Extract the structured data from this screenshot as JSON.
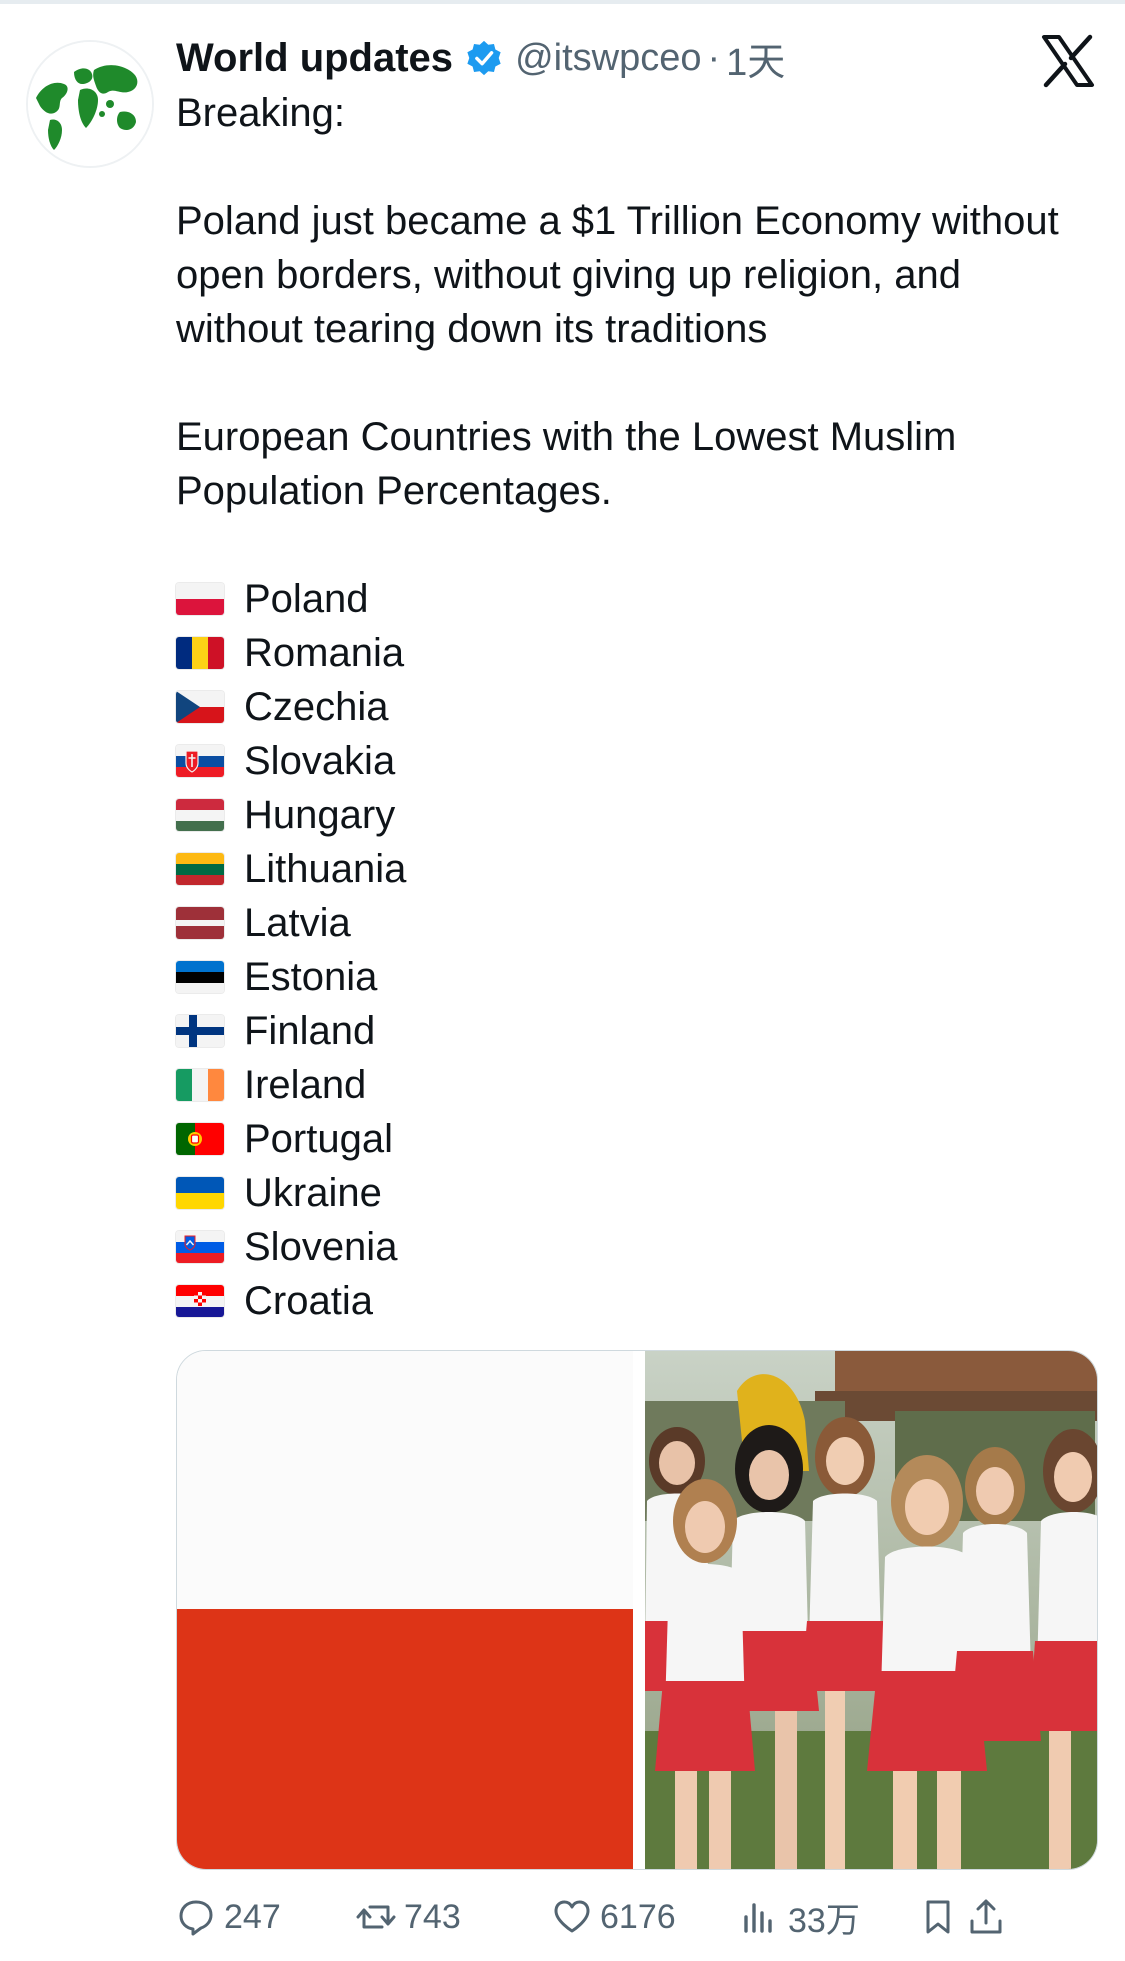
{
  "accent_color": "#1d9bf0",
  "post": {
    "author": {
      "display_name": "World updates",
      "handle": "@itswpceo",
      "separator": "·",
      "time": "1天",
      "verified": true,
      "avatar_icon": "globe-avatar-icon"
    },
    "platform_icon": "x-logo-icon",
    "text": {
      "line1": "Breaking:",
      "paragraph2": "Poland just became a $1 Trillion Economy without open borders, without giving up religion, and without tearing down its traditions",
      "paragraph3": "European Countries with the Lowest Muslim Population Percentages."
    },
    "countries": [
      {
        "name": "Poland",
        "flag": "flag-poland-icon"
      },
      {
        "name": "Romania",
        "flag": "flag-romania-icon"
      },
      {
        "name": "Czechia",
        "flag": "flag-czechia-icon"
      },
      {
        "name": "Slovakia",
        "flag": "flag-slovakia-icon"
      },
      {
        "name": "Hungary",
        "flag": "flag-hungary-icon"
      },
      {
        "name": "Lithuania",
        "flag": "flag-lithuania-icon"
      },
      {
        "name": "Latvia",
        "flag": "flag-latvia-icon"
      },
      {
        "name": "Estonia",
        "flag": "flag-estonia-icon"
      },
      {
        "name": "Finland",
        "flag": "flag-finland-icon"
      },
      {
        "name": "Ireland",
        "flag": "flag-ireland-icon"
      },
      {
        "name": "Portugal",
        "flag": "flag-portugal-icon"
      },
      {
        "name": "Ukraine",
        "flag": "flag-ukraine-icon"
      },
      {
        "name": "Slovenia",
        "flag": "flag-slovenia-icon"
      },
      {
        "name": "Croatia",
        "flag": "flag-croatia-icon"
      }
    ],
    "media": [
      {
        "kind": "image",
        "icon": "polish-flag-image"
      },
      {
        "kind": "image",
        "icon": "group-photo-image"
      }
    ],
    "actions": {
      "replies": "247",
      "reposts": "743",
      "likes": "6176",
      "views": "33万"
    }
  }
}
